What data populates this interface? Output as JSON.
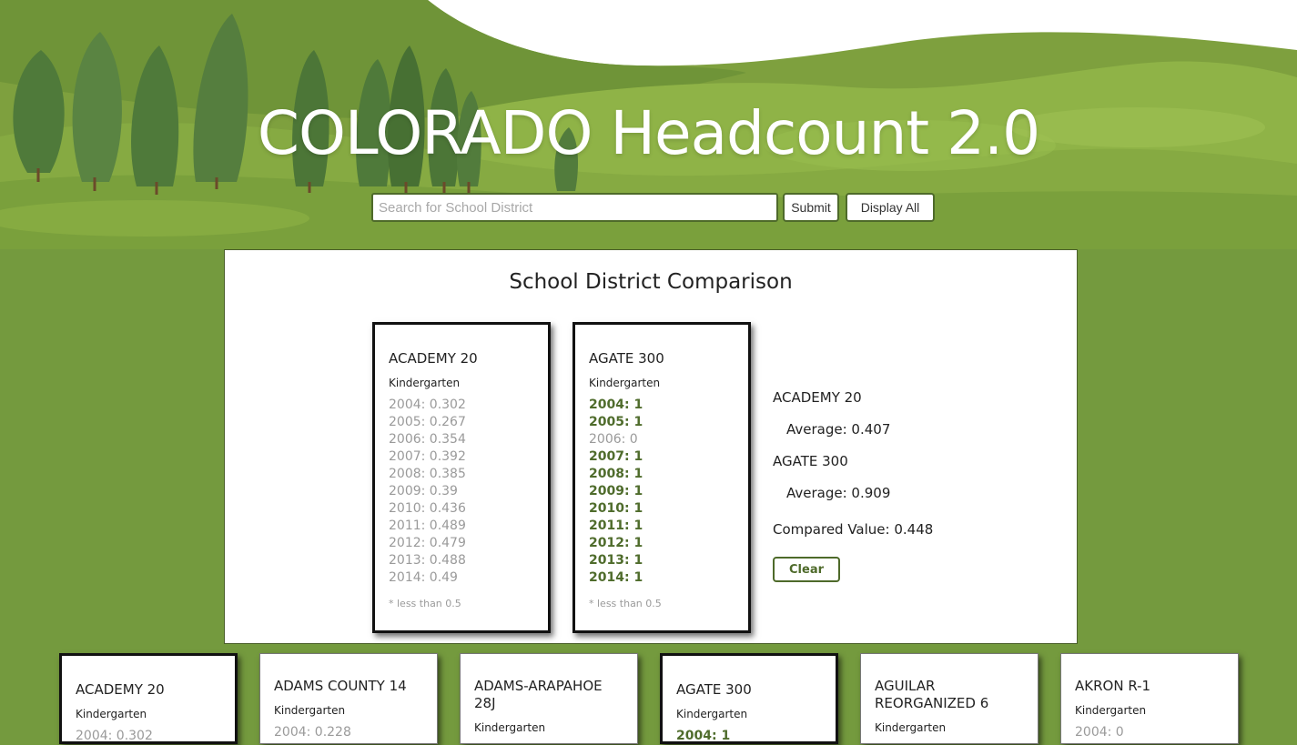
{
  "header": {
    "title": "COLORADO Headcount 2.0",
    "search_placeholder": "Search for School District",
    "submit_label": "Submit",
    "display_all_label": "Display All"
  },
  "comparison": {
    "title": "School District Comparison",
    "cards": [
      {
        "name": "ACADEMY 20",
        "grade": "Kindergarten",
        "rows": [
          "2004: 0.302",
          "2005: 0.267",
          "2006: 0.354",
          "2007: 0.392",
          "2008: 0.385",
          "2009: 0.39",
          "2010: 0.436",
          "2011: 0.489",
          "2012: 0.479",
          "2013: 0.488",
          "2014: 0.49"
        ],
        "note": "* less than 0.5"
      },
      {
        "name": "AGATE 300",
        "grade": "Kindergarten",
        "rows": [
          "2004: 1",
          "2005: 1",
          "2006: 0",
          "2007: 1",
          "2008: 1",
          "2009: 1",
          "2010: 1",
          "2011: 1",
          "2012: 1",
          "2013: 1",
          "2014: 1"
        ],
        "note": "* less than 0.5"
      }
    ],
    "summary": {
      "district_a": "ACADEMY 20",
      "average_a": "Average: 0.407",
      "district_b": "AGATE 300",
      "average_b": "Average: 0.909",
      "compared": "Compared Value: 0.448"
    },
    "clear_label": "Clear"
  },
  "districts": [
    {
      "name": "ACADEMY 20",
      "grade": "Kindergarten",
      "first_row": "2004: 0.302"
    },
    {
      "name": "ADAMS COUNTY 14",
      "grade": "Kindergarten",
      "first_row": "2004: 0.228"
    },
    {
      "name": "ADAMS-ARAPAHOE 28J",
      "grade": "Kindergarten",
      "first_row": ""
    },
    {
      "name": "AGATE 300",
      "grade": "Kindergarten",
      "first_row": "2004: 1"
    },
    {
      "name": "AGUILAR REORGANIZED 6",
      "grade": "Kindergarten",
      "first_row": ""
    },
    {
      "name": "AKRON R-1",
      "grade": "Kindergarten",
      "first_row": "2004: 0"
    }
  ],
  "colors": {
    "background": "#749a3e",
    "accent": "#4e6a2a",
    "above_threshold_text": "#4f6c2c",
    "below_threshold_text": "#9a9a9a"
  }
}
